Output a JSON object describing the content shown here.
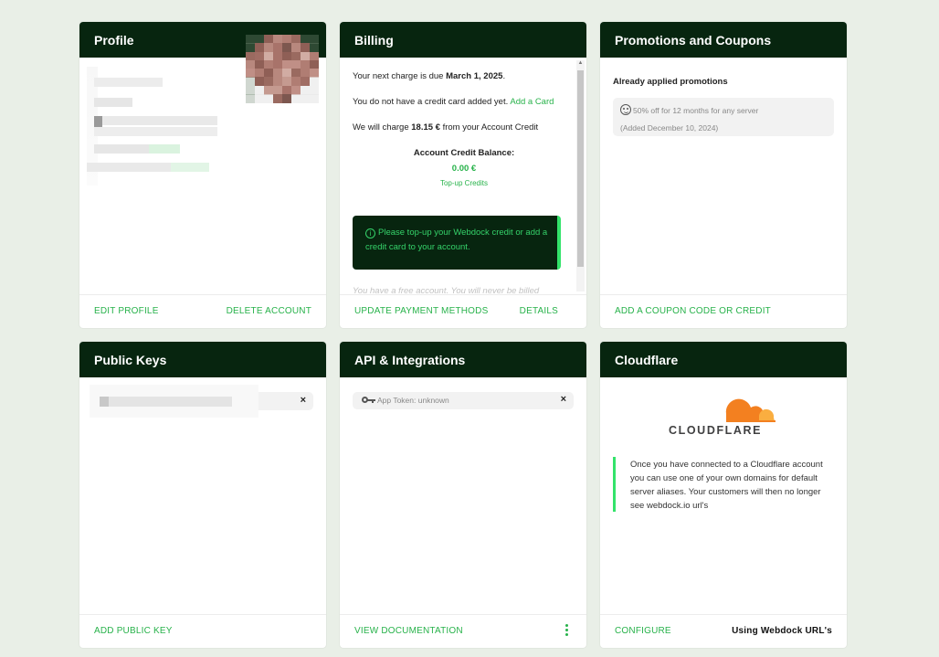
{
  "profile": {
    "title": "Profile",
    "edit_label": "EDIT PROFILE",
    "delete_label": "DELETE ACCOUNT"
  },
  "billing": {
    "title": "Billing",
    "next_charge_prefix": "Your next charge is due ",
    "next_charge_date": "March 1, 2025",
    "next_charge_suffix": ".",
    "no_card_text": "You do not have a credit card added yet. ",
    "add_card_link": "Add a Card",
    "charge_prefix": "We will charge ",
    "charge_amount": "18.15 €",
    "charge_suffix": " from your Account Credit",
    "balance_label": "Account Credit Balance:",
    "balance_value": "0.00 €",
    "topup_label": "Top-up Credits",
    "alert_text": "Please top-up your Webdock credit or add a credit card to your account.",
    "free_account_text": "You have a free account. You will never be billed",
    "update_label": "UPDATE PAYMENT METHODS",
    "details_label": "DETAILS"
  },
  "promotions": {
    "title": "Promotions and Coupons",
    "applied_title": "Already applied promotions",
    "promo_text": "50% off for 12 months for any server",
    "promo_added": "(Added December 10, 2024)",
    "add_coupon_label": "ADD A COUPON CODE OR CREDIT"
  },
  "public_keys": {
    "title": "Public Keys",
    "remove_symbol": "×",
    "add_label": "ADD PUBLIC KEY"
  },
  "api": {
    "title": "API & Integrations",
    "token_text": "App Token: unknown",
    "remove_symbol": "×",
    "docs_label": "VIEW DOCUMENTATION"
  },
  "cloudflare": {
    "title": "Cloudflare",
    "logo_text": "CLOUDFLARE",
    "description": "Once you have connected to a Cloudflare account you can use one of your own domains for default server aliases. Your customers will then no longer see webdock.io url's",
    "configure_label": "CONFIGURE",
    "using_label": "Using Webdock URL's"
  },
  "colors": {
    "header_bg": "#07250f",
    "accent_green": "#27b24a",
    "bright_green": "#33e36a",
    "page_bg": "#e9efe7",
    "cloudflare_orange": "#f38020"
  }
}
